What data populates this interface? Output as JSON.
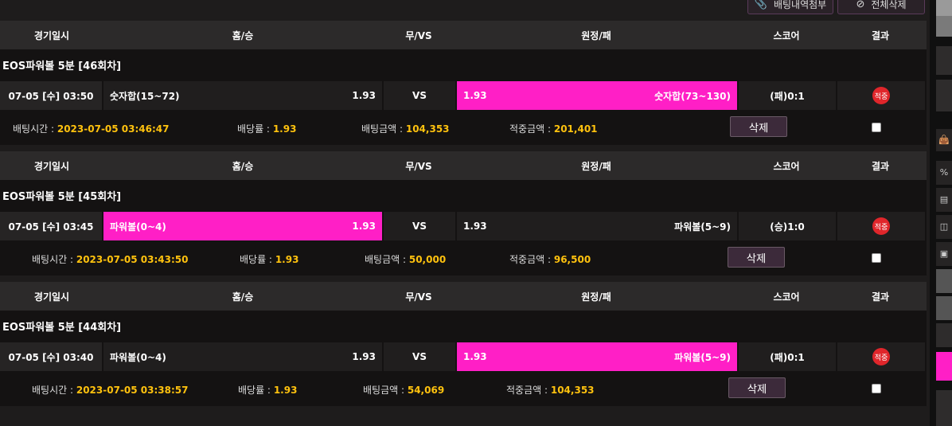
{
  "toolbar": {
    "history_label": "배팅내역첨부",
    "delete_all_label": "전체삭제"
  },
  "columns": [
    "경기일시",
    "홈/승",
    "무/VS",
    "원정/패",
    "스코어",
    "결과"
  ],
  "bets": [
    {
      "round": "EOS파워볼 5분 [46회차]",
      "time": "07-05 [수] 03:50",
      "home_label": "숫자합(15~72)",
      "home_odds": "1.93",
      "vs": "VS",
      "away_odds": "1.93",
      "away_label": "숫자합(73~130)",
      "score": "(패)0:1",
      "result": "적중",
      "selected": "away",
      "bet_time_label": "배팅시간 :",
      "bet_time": "2023-07-05 03:46:47",
      "rate_label": "배당률 :",
      "rate": "1.93",
      "amount_label": "배팅금액 :",
      "amount": "104,353",
      "win_label": "적중금액 :",
      "win": "201,401",
      "delete_label": "삭제"
    },
    {
      "round": "EOS파워볼 5분 [45회차]",
      "time": "07-05 [수] 03:45",
      "home_label": "파워볼(0~4)",
      "home_odds": "1.93",
      "vs": "VS",
      "away_odds": "1.93",
      "away_label": "파워볼(5~9)",
      "score": "(승)1:0",
      "result": "적중",
      "selected": "home",
      "bet_time_label": "배팅시간 :",
      "bet_time": "2023-07-05 03:43:50",
      "rate_label": "배당률 :",
      "rate": "1.93",
      "amount_label": "배팅금액 :",
      "amount": "50,000",
      "win_label": "적중금액 :",
      "win": "96,500",
      "delete_label": "삭제"
    },
    {
      "round": "EOS파워볼 5분 [44회차]",
      "time": "07-05 [수] 03:40",
      "home_label": "파워볼(0~4)",
      "home_odds": "1.93",
      "vs": "VS",
      "away_odds": "1.93",
      "away_label": "파워볼(5~9)",
      "score": "(패)0:1",
      "result": "적중",
      "selected": "away",
      "bet_time_label": "배팅시간 :",
      "bet_time": "2023-07-05 03:38:57",
      "rate_label": "배당률 :",
      "rate": "1.93",
      "amount_label": "배팅금액 :",
      "amount": "54,069",
      "win_label": "적중금액 :",
      "win": "104,353",
      "delete_label": "삭제"
    }
  ],
  "colors": {
    "selected": "#ff1fc6",
    "result_badge": "#e0262b",
    "highlight_value": "#ffc20e"
  },
  "rail": {
    "percent_icon": "%"
  }
}
